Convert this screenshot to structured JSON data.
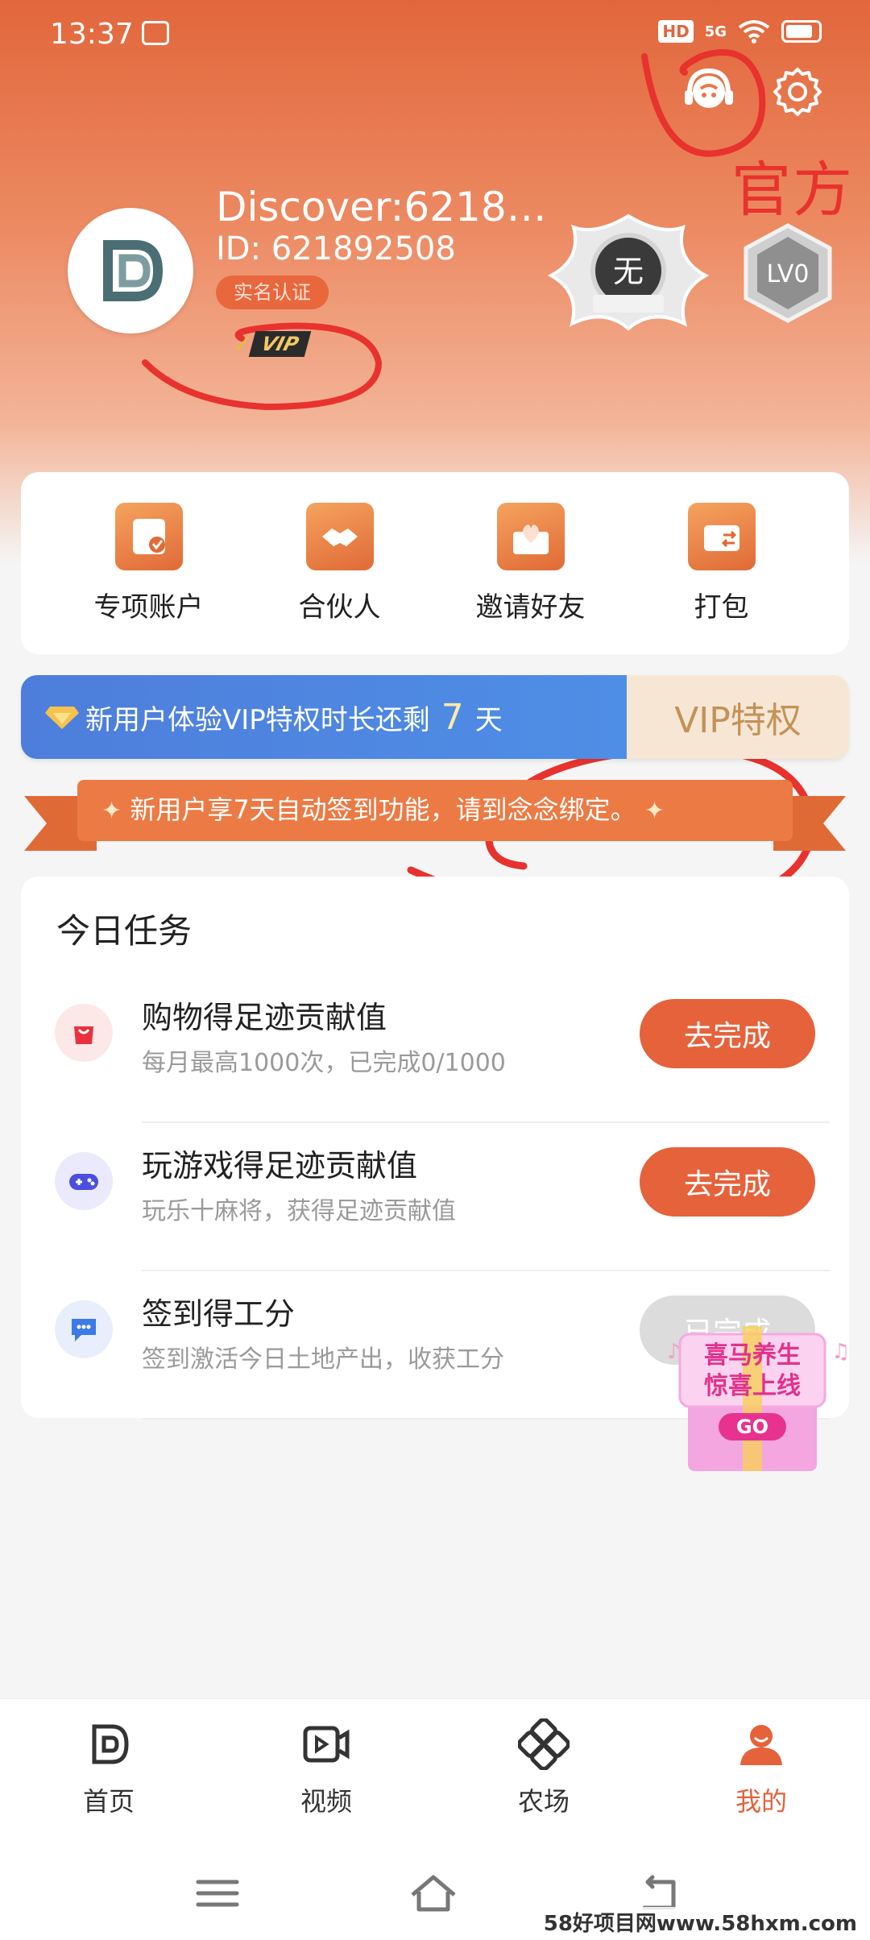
{
  "status_bar": {
    "time": "13:37",
    "hd": "HD",
    "network": "5G"
  },
  "annotation": {
    "text": "官方"
  },
  "profile": {
    "username": "Discover:6218…",
    "user_id": "ID: 621892508",
    "realname_tag": "实名认证",
    "vip_badge": "VIP",
    "medal_none": "无",
    "level": "LV0"
  },
  "quick_actions": [
    {
      "label": "专项账户",
      "icon": "special-account-icon"
    },
    {
      "label": "合伙人",
      "icon": "partner-icon"
    },
    {
      "label": "邀请好友",
      "icon": "invite-friends-icon"
    },
    {
      "label": "打包",
      "icon": "wallet-pack-icon"
    }
  ],
  "vip_banner": {
    "text": "新用户体验VIP特权时长还剩",
    "days": "7",
    "unit": "天",
    "button": "VIP特权"
  },
  "ribbon": {
    "text": "新用户享7天自动签到功能，请到念念绑定。"
  },
  "tasks": {
    "title": "今日任务",
    "items": [
      {
        "title": "购物得足迹贡献值",
        "desc": "每月最高1000次，已完成0/1000",
        "button": "去完成",
        "icon": "shopping-bag-icon",
        "status": "todo"
      },
      {
        "title": "玩游戏得足迹贡献值",
        "desc": "玩乐十麻将，获得足迹贡献值",
        "button": "去完成",
        "icon": "gamepad-icon",
        "status": "todo"
      },
      {
        "title": "签到得工分",
        "desc": "签到激活今日土地产出，收获工分",
        "button": "已完成",
        "icon": "chat-bubble-icon",
        "status": "done"
      }
    ]
  },
  "promo": {
    "line1": "喜马养生",
    "line2": "惊喜上线",
    "go": "GO"
  },
  "bottom_nav": [
    {
      "label": "首页",
      "icon": "home-logo-icon",
      "active": false
    },
    {
      "label": "视频",
      "icon": "video-icon",
      "active": false
    },
    {
      "label": "农场",
      "icon": "farm-icon",
      "active": false
    },
    {
      "label": "我的",
      "icon": "profile-icon",
      "active": true
    }
  ],
  "watermark": "58好项目网www.58hxm.com",
  "colors": {
    "accent": "#e5623b",
    "vip_blue": "#4d7edb",
    "vip_gold": "#c39259"
  }
}
